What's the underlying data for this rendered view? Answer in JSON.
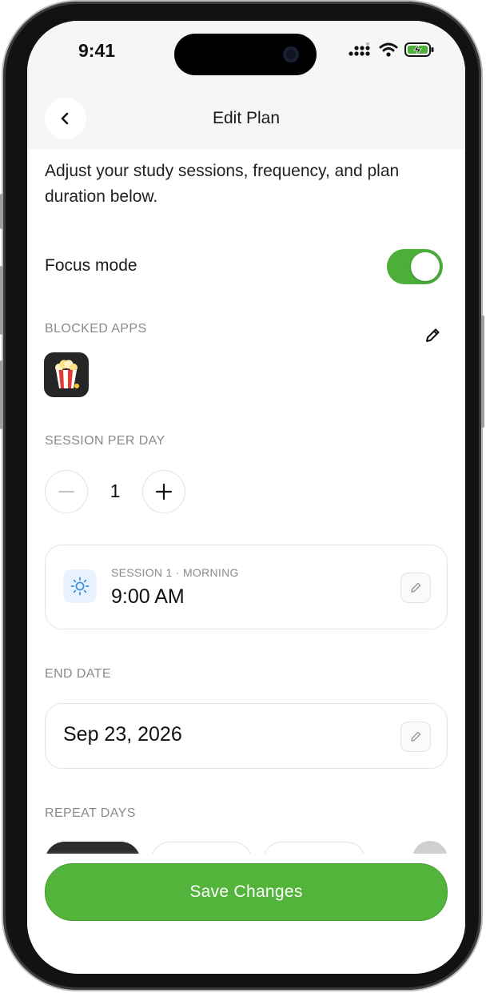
{
  "status_bar": {
    "time": "9:41"
  },
  "header": {
    "title": "Edit Plan"
  },
  "description": "Adjust your study sessions, frequency, and plan duration below.",
  "focus_mode": {
    "label": "Focus mode",
    "enabled": true
  },
  "blocked_apps": {
    "label": "BLOCKED APPS",
    "apps": [
      "popcorn-app-icon"
    ]
  },
  "sessions_per_day": {
    "label": "SESSION PER DAY",
    "value": "1"
  },
  "session_card": {
    "label": "SESSION 1 · MORNING",
    "time": "9:00 AM",
    "icon": "sun-icon"
  },
  "end_date": {
    "label": "END DATE",
    "value": "Sep 23, 2026"
  },
  "repeat_days": {
    "label": "REPEAT DAYS"
  },
  "save_button": {
    "label": "Save Changes"
  },
  "colors": {
    "accent_green": "#53b43c",
    "toggle_green": "#4caf3a",
    "sun_blue": "#3d8fe0"
  }
}
